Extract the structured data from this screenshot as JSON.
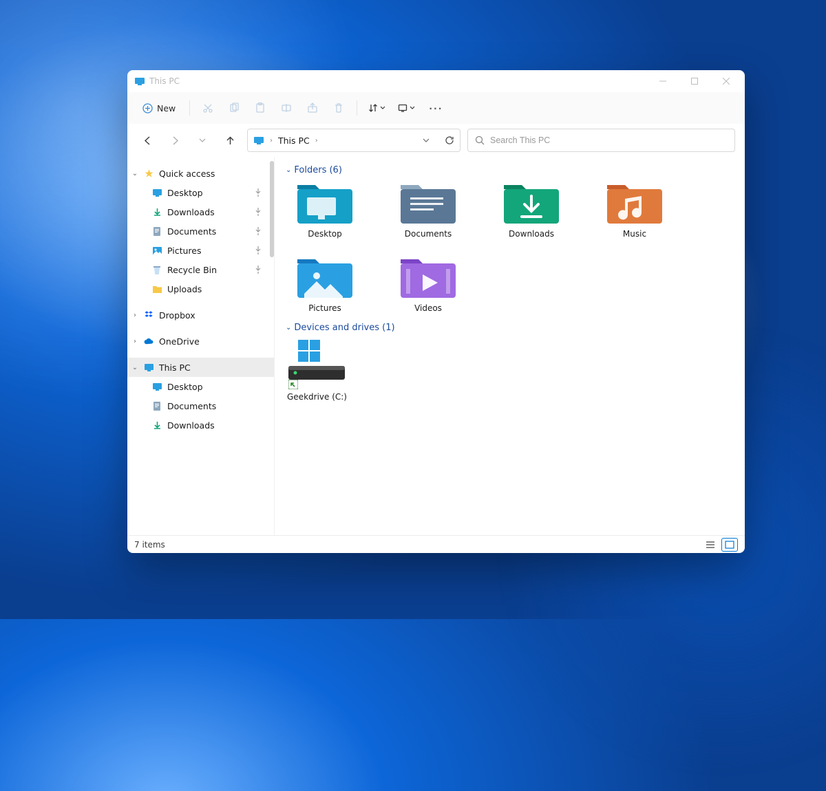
{
  "window": {
    "title": "This PC"
  },
  "toolbar": {
    "new_label": "New",
    "sort_label": "",
    "view_label": "",
    "more_label": "···"
  },
  "address": {
    "segments": [
      "This PC"
    ]
  },
  "search": {
    "placeholder": "Search This PC"
  },
  "sidebar": {
    "quick_access": {
      "label": "Quick access"
    },
    "items": [
      {
        "label": "Desktop",
        "pinned": true,
        "icon": "desktop"
      },
      {
        "label": "Downloads",
        "pinned": true,
        "icon": "downloads"
      },
      {
        "label": "Documents",
        "pinned": true,
        "icon": "documents"
      },
      {
        "label": "Pictures",
        "pinned": true,
        "icon": "pictures"
      },
      {
        "label": "Recycle Bin",
        "pinned": true,
        "icon": "recycle"
      },
      {
        "label": "Uploads",
        "pinned": false,
        "icon": "folder"
      }
    ],
    "dropbox": {
      "label": "Dropbox"
    },
    "onedrive": {
      "label": "OneDrive"
    },
    "thispc": {
      "label": "This PC"
    },
    "thispc_children": [
      {
        "label": "Desktop",
        "icon": "desktop"
      },
      {
        "label": "Documents",
        "icon": "documents"
      },
      {
        "label": "Downloads",
        "icon": "downloads"
      }
    ]
  },
  "sections": {
    "folders": {
      "title": "Folders (6)"
    },
    "drives": {
      "title": "Devices and drives (1)"
    }
  },
  "folders": [
    {
      "label": "Desktop",
      "kind": "desktop"
    },
    {
      "label": "Documents",
      "kind": "documents"
    },
    {
      "label": "Downloads",
      "kind": "downloads"
    },
    {
      "label": "Music",
      "kind": "music"
    },
    {
      "label": "Pictures",
      "kind": "pictures"
    },
    {
      "label": "Videos",
      "kind": "videos"
    }
  ],
  "drives": [
    {
      "label": "Geekdrive (C:)"
    }
  ],
  "status": {
    "text": "7 items"
  },
  "colors": {
    "accent": "#1b4a9c",
    "desktop": [
      "#15a0c8",
      "#0a7ea3"
    ],
    "documents": [
      "#5a7896",
      "#8ea8be"
    ],
    "downloads": [
      "#13a67a",
      "#0c8360"
    ],
    "music": [
      "#e07a3c",
      "#c95d2a"
    ],
    "pictures": [
      "#2aa0e2",
      "#1579c0"
    ],
    "videos": [
      "#a06ae2",
      "#7b44c8"
    ]
  }
}
